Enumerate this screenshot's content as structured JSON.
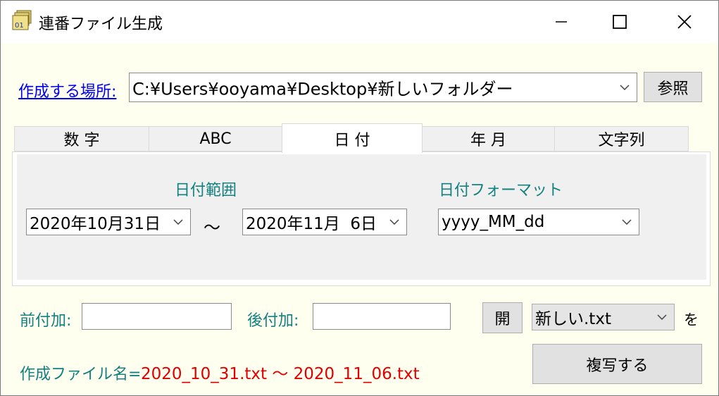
{
  "window": {
    "title": "連番ファイル生成",
    "icon": "folder-stack-01-icon",
    "icon_text": "01",
    "controls": [
      "minimize-icon",
      "maximize-icon",
      "close-icon"
    ]
  },
  "location": {
    "label": "作成する場所:",
    "path": "C:¥Users¥ooyama¥Desktop¥新しいフォルダー",
    "browse_label": "参照"
  },
  "tabs": [
    {
      "label": "数 字",
      "active": false
    },
    {
      "label": "ABC",
      "active": false
    },
    {
      "label": "日 付",
      "active": true
    },
    {
      "label": "年 月",
      "active": false
    },
    {
      "label": "文字列",
      "active": false
    }
  ],
  "date_panel": {
    "range_label": "日付範囲",
    "format_label": "日付フォーマット",
    "start_date": "2020年10月31日",
    "tilde": "～",
    "end_date": "2020年11月  6日",
    "format_value": "yyyy_MM_dd"
  },
  "affix": {
    "prefix_label": "前付加:",
    "prefix_value": "",
    "suffix_label": "後付加:",
    "suffix_value": ""
  },
  "template": {
    "open_label": "開",
    "file_value": "新しい.txt",
    "wo_label": "を"
  },
  "output": {
    "label": "作成ファイル名=",
    "preview": "2020_10_31.txt ～ 2020_11_06.txt",
    "copy_label": "複写する"
  },
  "colors": {
    "background": "#fffff0",
    "link": "#0000ee",
    "teal_label": "#138080",
    "preview_red": "#e00000"
  }
}
